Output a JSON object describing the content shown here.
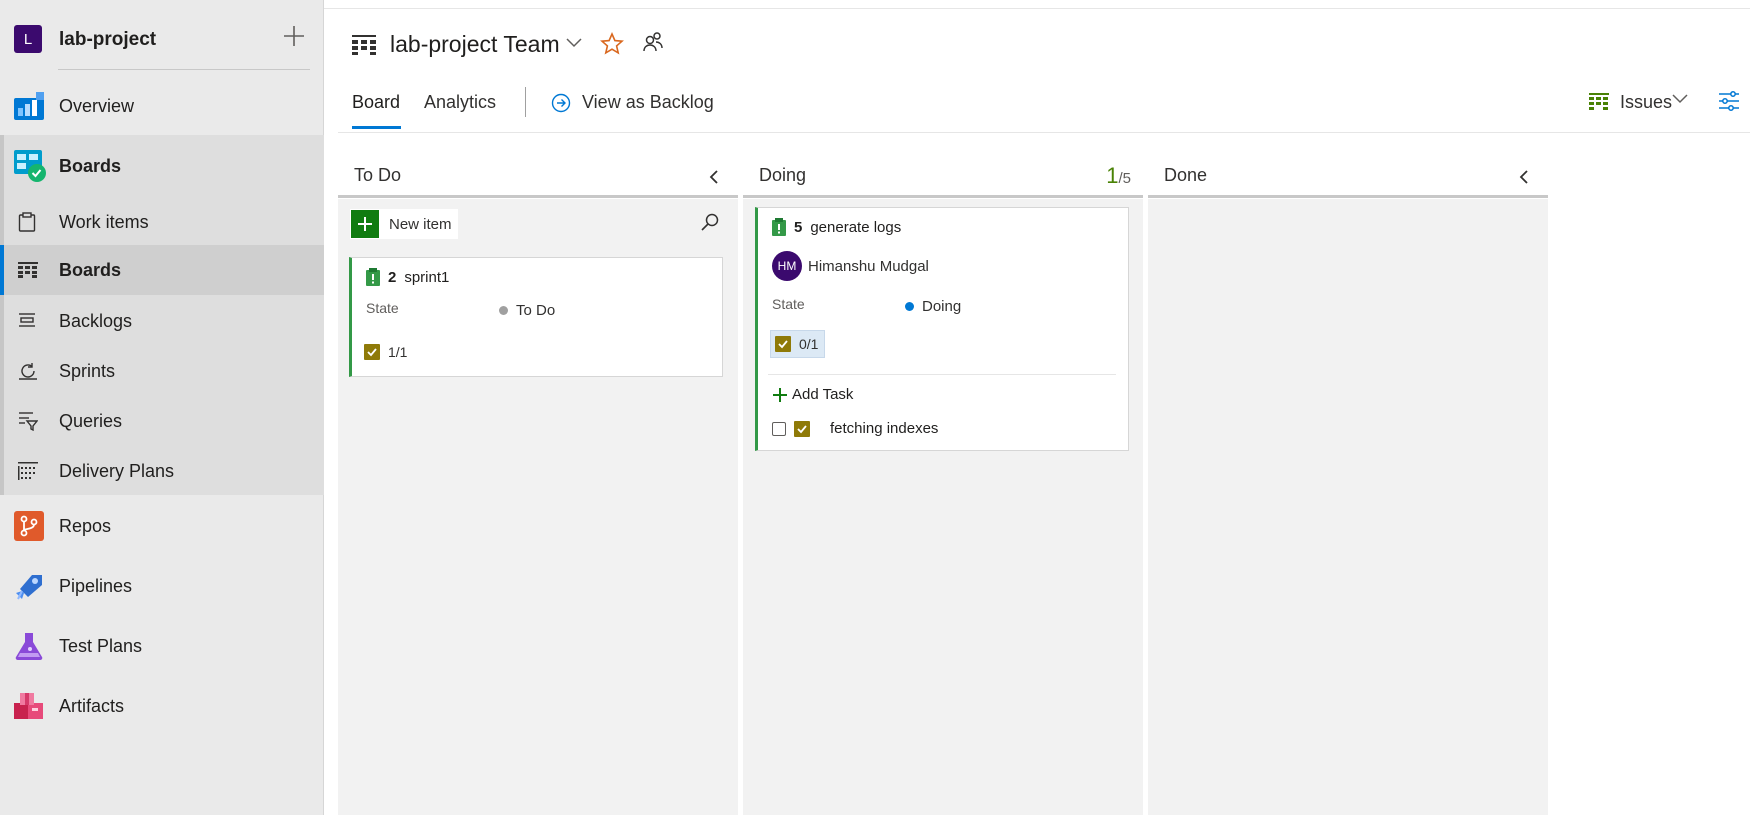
{
  "project": {
    "initial": "L",
    "name": "lab-project"
  },
  "nav": {
    "overview": "Overview",
    "boards_group": "Boards",
    "work_items": "Work items",
    "boards": "Boards",
    "backlogs": "Backlogs",
    "sprints": "Sprints",
    "queries": "Queries",
    "delivery_plans": "Delivery Plans",
    "repos": "Repos",
    "pipelines": "Pipelines",
    "test_plans": "Test Plans",
    "artifacts": "Artifacts"
  },
  "header": {
    "team": "lab-project Team",
    "tabs": {
      "board": "Board",
      "analytics": "Analytics"
    },
    "backlog_link": "View as Backlog",
    "issues": "Issues"
  },
  "columns": [
    {
      "title": "To Do",
      "new_item": "New item",
      "cards": [
        {
          "id": "2",
          "title": "sprint1",
          "state_label": "State",
          "state": "To Do",
          "children": "1/1"
        }
      ]
    },
    {
      "title": "Doing",
      "wip_current": "1",
      "wip_limit": "/5",
      "cards": [
        {
          "id": "5",
          "title": "generate logs",
          "assignee_initials": "HM",
          "assignee": "Himanshu Mudgal",
          "state_label": "State",
          "state": "Doing",
          "children": "0/1",
          "add_task": "Add Task",
          "tasks": [
            {
              "title": "fetching indexes"
            }
          ]
        }
      ]
    },
    {
      "title": "Done",
      "cards": []
    }
  ],
  "colors": {
    "accent": "#0078d4",
    "story_bar": "#339947",
    "task_check": "#8f7a08",
    "todo_dot": "#a0a0a0",
    "doing_dot": "#0078d4",
    "new_item_green": "#107c10"
  }
}
